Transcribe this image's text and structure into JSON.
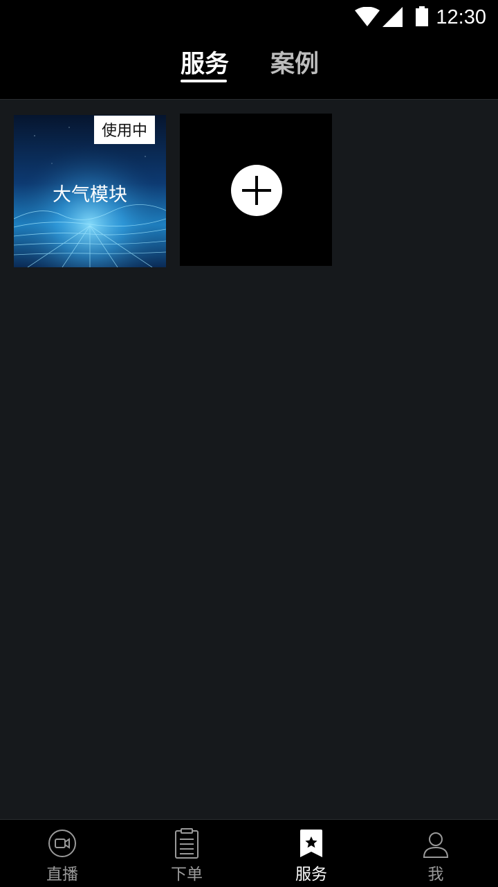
{
  "status_bar": {
    "time": "12:30",
    "icons": [
      "wifi-icon",
      "signal-icon",
      "battery-icon"
    ]
  },
  "header": {
    "tabs": [
      {
        "label": "服务",
        "active": true
      },
      {
        "label": "案例",
        "active": false
      }
    ]
  },
  "services": {
    "cards": [
      {
        "title": "大气模块",
        "badge": "使用中"
      }
    ],
    "add_icon": "plus-icon"
  },
  "bottom_nav": {
    "items": [
      {
        "label": "直播",
        "icon": "video-camera-icon",
        "active": false
      },
      {
        "label": "下单",
        "icon": "clipboard-icon",
        "active": false
      },
      {
        "label": "服务",
        "icon": "star-bookmark-icon",
        "active": true
      },
      {
        "label": "我",
        "icon": "person-icon",
        "active": false
      }
    ]
  },
  "colors": {
    "background": "#16191c",
    "bar": "#000000",
    "active_text": "#ffffff",
    "inactive_text": "#9a9a9a"
  }
}
